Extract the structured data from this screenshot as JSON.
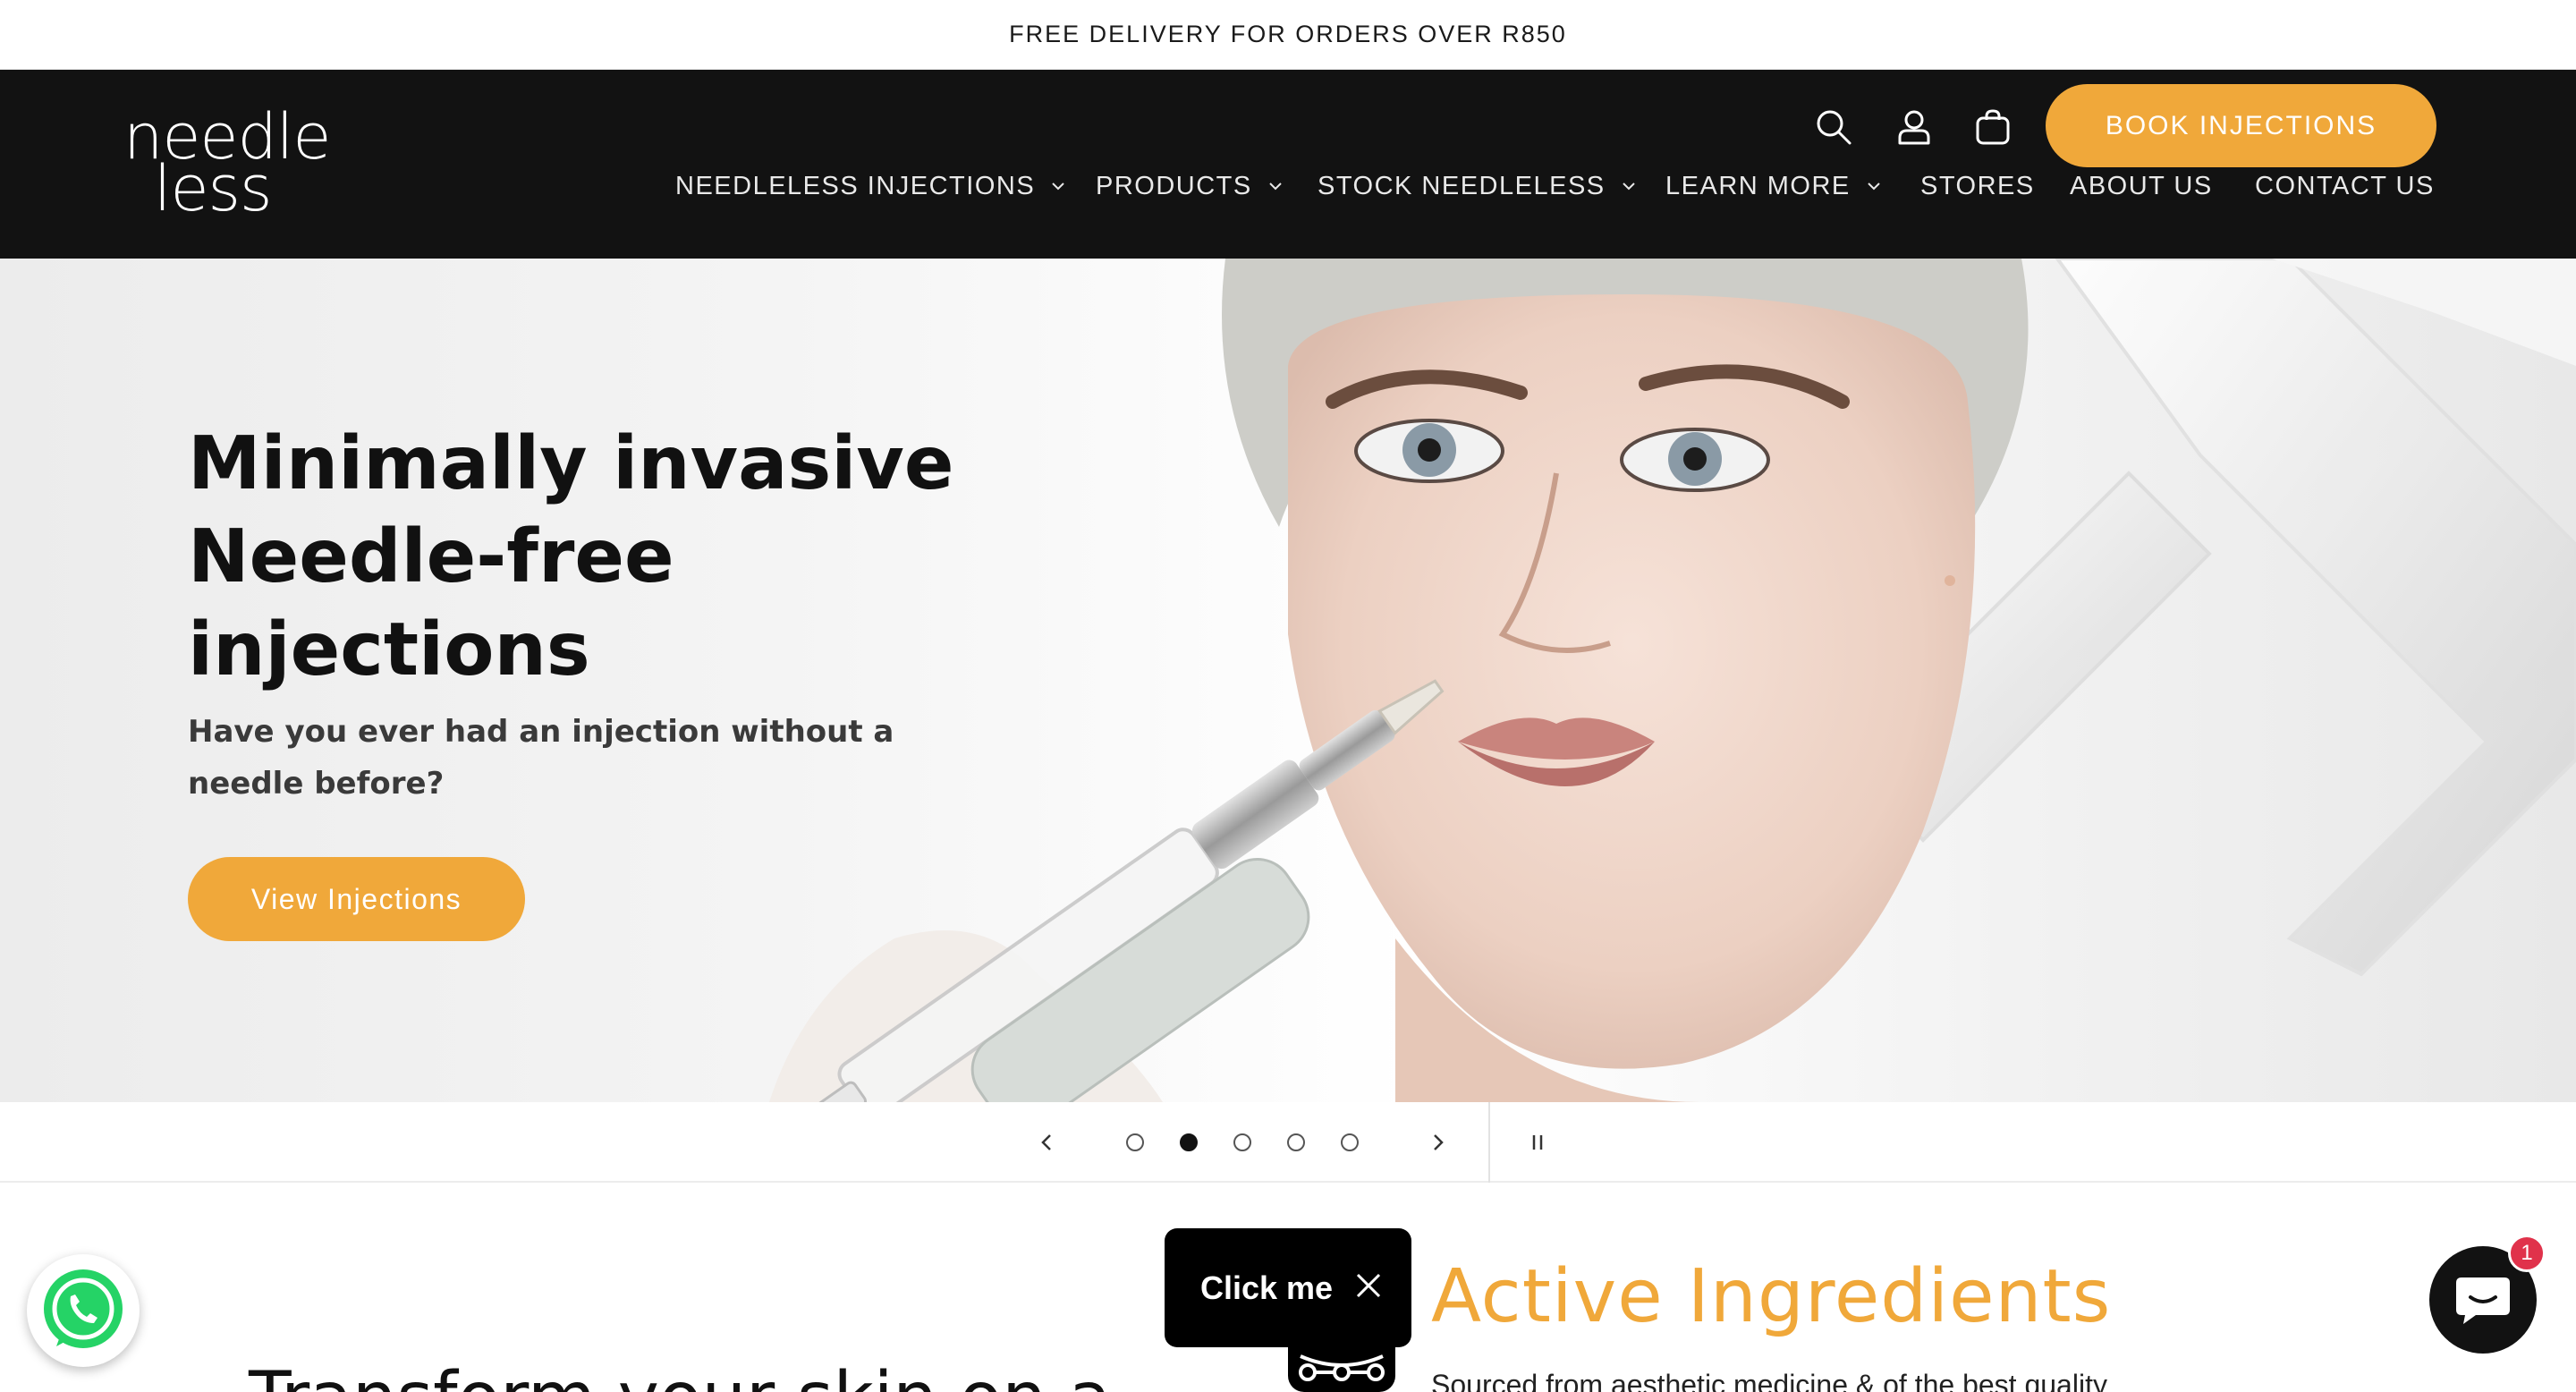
{
  "announcement": {
    "text": "FREE DELIVERY FOR ORDERS OVER R850"
  },
  "header": {
    "logo": {
      "line1": "needle",
      "line2": "less"
    },
    "icons": [
      "search-icon",
      "account-icon",
      "cart-icon"
    ],
    "book_button": "BOOK INJECTIONS",
    "nav": [
      {
        "label": "NEEDLELESS INJECTIONS",
        "has_dropdown": true
      },
      {
        "label": "PRODUCTS",
        "has_dropdown": true
      },
      {
        "label": "STOCK NEEDLELESS",
        "has_dropdown": true
      },
      {
        "label": "LEARN MORE",
        "has_dropdown": true
      },
      {
        "label": "STORES",
        "has_dropdown": false
      },
      {
        "label": "ABOUT US",
        "has_dropdown": false
      },
      {
        "label": "CONTACT US",
        "has_dropdown": false
      }
    ]
  },
  "hero": {
    "title_lines": [
      "Minimally invasive",
      "Needle-free",
      "injections"
    ],
    "subtitle": "Have you ever had an injection without a needle before?",
    "button": "View Injections"
  },
  "slider": {
    "slide_count": 5,
    "active_index": 1,
    "icons": [
      "chevron-left-icon",
      "chevron-right-icon",
      "pause-icon"
    ]
  },
  "section": {
    "heading_partial": "Transform your skin on a",
    "active_title": "Active Ingredients",
    "active_text_partial": "Sourced from aesthetic medicine & of the best quality"
  },
  "widgets": {
    "click_me": "Click me",
    "chat_badge": "1",
    "colors": {
      "accent": "#f0a83a",
      "header_bg": "#121212",
      "badge": "#e0324b",
      "whatsapp": "#25d366"
    }
  }
}
